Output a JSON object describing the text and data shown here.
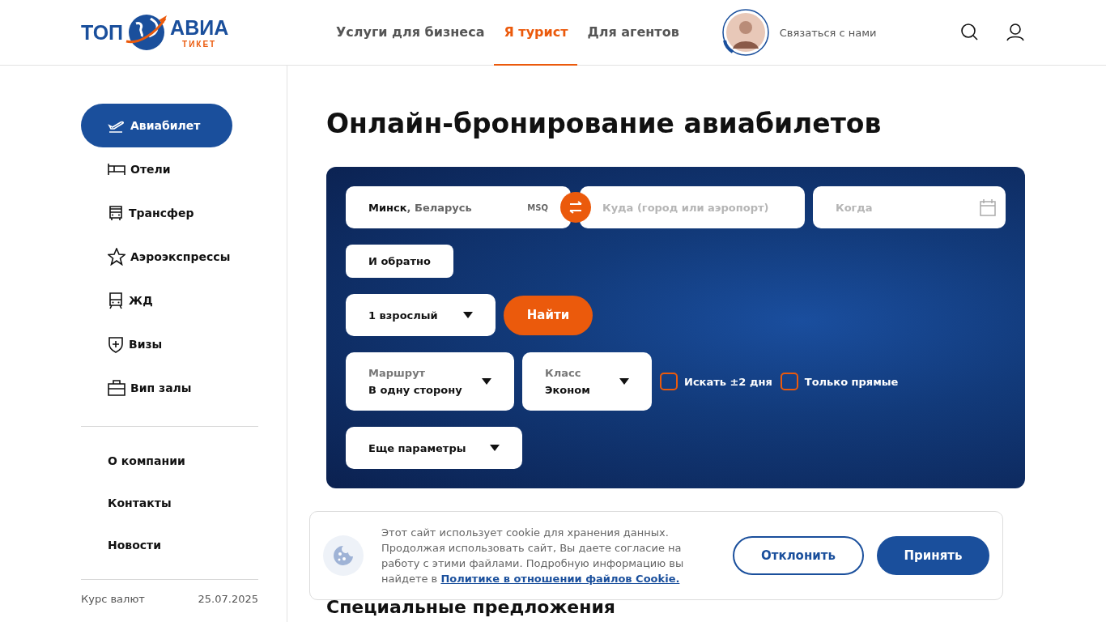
{
  "logo": {
    "left": "ТОП",
    "right": "АВИА",
    "sub": "ТИКЕТ"
  },
  "nav": [
    {
      "label": "Услуги для бизнеса",
      "selected": false
    },
    {
      "label": "Я турист",
      "selected": true
    },
    {
      "label": "Для агентов",
      "selected": false
    }
  ],
  "contact": {
    "label": "Связаться с нами"
  },
  "sidebar": {
    "services": [
      {
        "label": "Авиабилет",
        "kind": "plane",
        "selected": true
      },
      {
        "label": "Отели",
        "kind": "bed",
        "selected": false
      },
      {
        "label": "Трансфер",
        "kind": "bus",
        "selected": false
      },
      {
        "label": "Аэроэкспрессы",
        "kind": "star",
        "selected": false
      },
      {
        "label": "ЖД",
        "kind": "train",
        "selected": false
      },
      {
        "label": "Визы",
        "kind": "shield",
        "selected": false
      },
      {
        "label": "Вип залы",
        "kind": "case",
        "selected": false
      }
    ],
    "links": [
      "О компании",
      "Контакты",
      "Новости"
    ],
    "rates": {
      "label": "Курс валют",
      "date": "25.07.2025"
    }
  },
  "title": "Онлайн-бронирование авиабилетов",
  "search": {
    "from": {
      "city": "Минск",
      "country": ", Беларусь",
      "code": "MSQ"
    },
    "to": {
      "placeholder": "Куда (город или аэропорт)"
    },
    "when": {
      "placeholder": "Когда"
    },
    "return_button": "И обратно",
    "passengers": "1 взрослый",
    "find_button": "Найти",
    "route": {
      "label": "Маршрут",
      "value": "В одну сторону"
    },
    "class": {
      "label": "Класс",
      "value": "Эконом"
    },
    "options": [
      {
        "label": "Искать ±2 дня",
        "checked": false
      },
      {
        "label": "Только прямые",
        "checked": false
      }
    ],
    "more": "Еще параметры"
  },
  "section_title": "Специальные предложения",
  "cookie": {
    "text": "Этот сайт использует cookie для хранения данных. Продолжая использовать сайт, Вы даете согласие на работу с этими файлами. Подробную информацию вы найдете в ",
    "link": "Политике в отношении файлов Cookie.",
    "decline": "Отклонить",
    "accept": "Принять"
  }
}
